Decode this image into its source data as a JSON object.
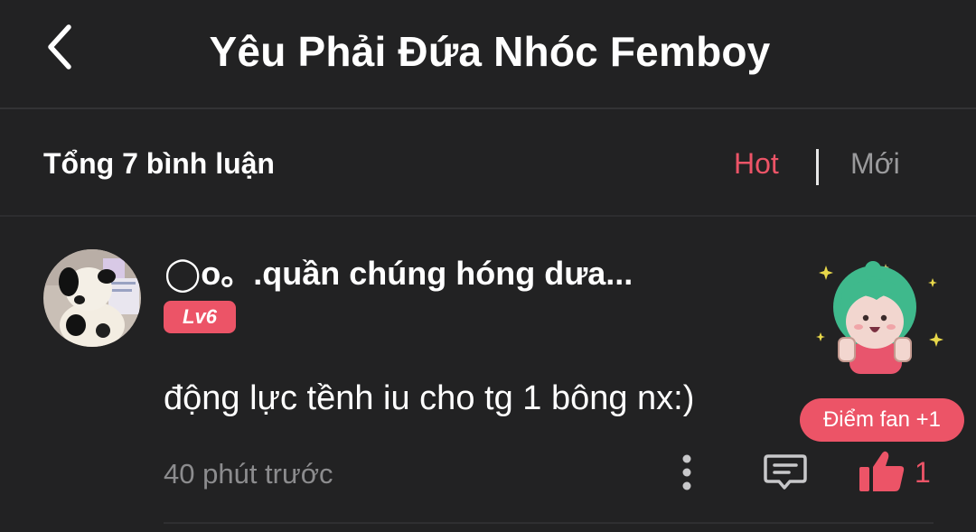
{
  "header": {
    "title": "Yêu Phải Đứa Nhóc Femboy",
    "back_icon": "chevron-left-icon"
  },
  "comments_bar": {
    "total_label": "Tổng 7 bình luận",
    "sort_hot": "Hot",
    "sort_new": "Mới",
    "active_sort_color": "#ec5467"
  },
  "comment": {
    "username": "◯o。.quần chúng hóng dưa...",
    "level": "Lv6",
    "text": "động lực tềnh iu cho tg 1 bông nx:)",
    "fan_badge": "Điểm fan +1",
    "time": "40 phút trước",
    "like_count": "1",
    "icons": [
      "more-vertical-icon",
      "reply-comment-icon",
      "thumbs-up-icon"
    ]
  },
  "colors": {
    "background": "#222223",
    "accent": "#ec5467",
    "muted_text": "#8c8c8e"
  }
}
